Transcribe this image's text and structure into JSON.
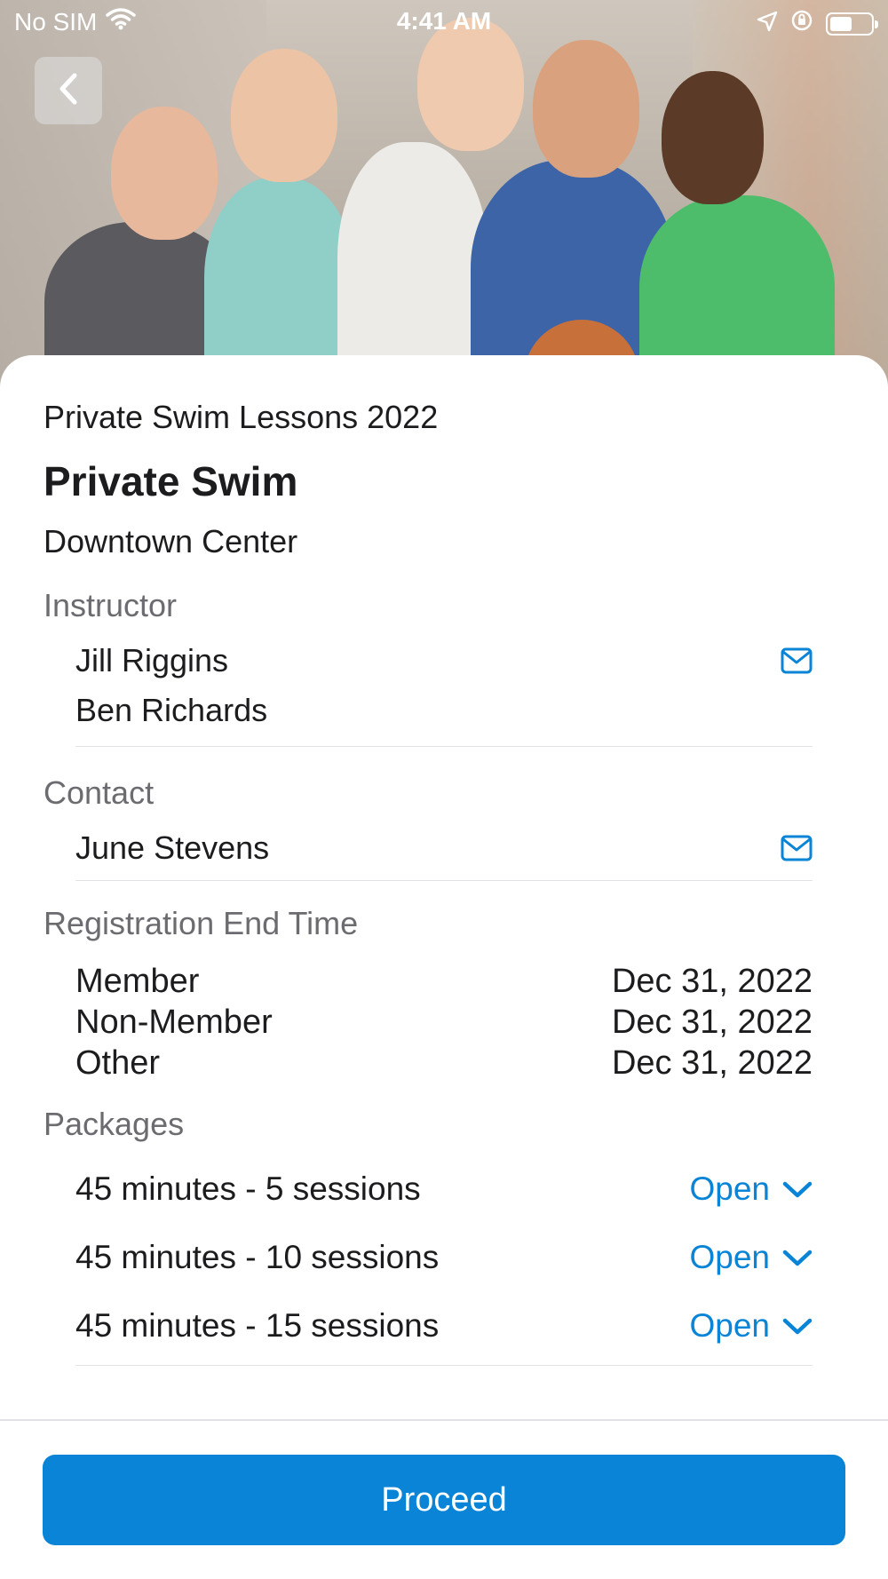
{
  "status_bar": {
    "carrier": "No SIM",
    "time": "4:41 AM"
  },
  "header": {
    "back_icon": "chevron-left-icon"
  },
  "program": {
    "series": "Private Swim Lessons 2022",
    "title": "Private Swim",
    "location": "Downtown Center"
  },
  "instructor": {
    "label": "Instructor",
    "names": [
      "Jill Riggins",
      "Ben Richards"
    ],
    "icon": "mail-icon"
  },
  "contact": {
    "label": "Contact",
    "names": [
      "June Stevens"
    ],
    "icon": "mail-icon"
  },
  "registration": {
    "label": "Registration End Time",
    "rows": [
      {
        "type": "Member",
        "date": "Dec 31, 2022"
      },
      {
        "type": "Non-Member",
        "date": "Dec 31, 2022"
      },
      {
        "type": "Other",
        "date": "Dec 31, 2022"
      }
    ]
  },
  "packages": {
    "label": "Packages",
    "items": [
      {
        "name": "45 minutes - 5 sessions",
        "status": "Open"
      },
      {
        "name": "45 minutes - 10 sessions",
        "status": "Open"
      },
      {
        "name": "45 minutes - 15 sessions",
        "status": "Open"
      }
    ]
  },
  "footer": {
    "proceed_label": "Proceed"
  },
  "colors": {
    "accent": "#0a84d6",
    "section_label": "#6b6b70",
    "divider": "#e2e2e6"
  }
}
